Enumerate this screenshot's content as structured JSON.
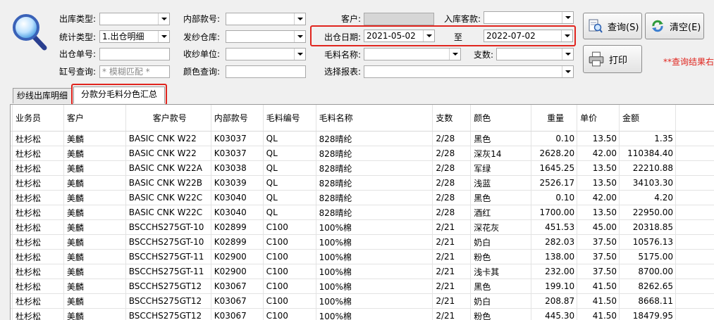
{
  "form": {
    "out_type_label": "出库类型:",
    "out_type_value": "",
    "stat_type_label": "统计类型:",
    "stat_type_value": "1.出仓明细",
    "out_no_label": "出仓单号:",
    "out_no_value": "",
    "vat_query_label": "缸号查询:",
    "vat_query_placeholder": "* 模糊匹配 *",
    "inner_style_label": "内部款号:",
    "inner_style_value": "",
    "warehouse_label": "发纱仓库:",
    "warehouse_value": "",
    "receiver_label": "收纱单位:",
    "receiver_value": "",
    "color_query_label": "颜色查询:",
    "color_query_value": "",
    "customer_label": "客户:",
    "customer_value": "",
    "in_customer_label": "入库客款:",
    "in_customer_value": "",
    "date_label": "出仓日期:",
    "date_from": "2021-05-02",
    "date_to_label": "至",
    "date_to": "2022-07-02",
    "material_label": "毛料名称:",
    "material_value": "",
    "count_label": "支数:",
    "count_value": "",
    "report_label": "选择报表:",
    "report_value": ""
  },
  "buttons": {
    "query": "查询(S)",
    "clear": "清空(E)",
    "print": "打印"
  },
  "hint": "**查询结果右",
  "tabs": [
    {
      "label": "纱线出库明细"
    },
    {
      "label": "分款分毛料分色汇总"
    }
  ],
  "table": {
    "headers": [
      "业务员",
      "客户",
      "客户款号",
      "内部款号",
      "毛料编号",
      "毛料名称",
      "支数",
      "颜色",
      "重量",
      "单价",
      "金额"
    ],
    "rows": [
      [
        "杜杉松",
        "美麟",
        "BASIC CNK W22",
        "K03037",
        "QL",
        "828晴纶",
        "2/28",
        "黑色",
        "0.10",
        "13.50",
        "1.35"
      ],
      [
        "杜杉松",
        "美麟",
        "BASIC CNK W22",
        "K03037",
        "QL",
        "828晴纶",
        "2/28",
        "深灰14",
        "2628.20",
        "42.00",
        "110384.40"
      ],
      [
        "杜杉松",
        "美麟",
        "BASIC CNK W22A",
        "K03038",
        "QL",
        "828晴纶",
        "2/28",
        "军绿",
        "1645.25",
        "13.50",
        "22210.88"
      ],
      [
        "杜杉松",
        "美麟",
        "BASIC CNK W22B",
        "K03039",
        "QL",
        "828晴纶",
        "2/28",
        "浅蓝",
        "2526.17",
        "13.50",
        "34103.30"
      ],
      [
        "杜杉松",
        "美麟",
        "BASIC CNK W22C",
        "K03040",
        "QL",
        "828晴纶",
        "2/28",
        "黑色",
        "0.10",
        "42.00",
        "4.20"
      ],
      [
        "杜杉松",
        "美麟",
        "BASIC CNK W22C",
        "K03040",
        "QL",
        "828晴纶",
        "2/28",
        "酒红",
        "1700.00",
        "13.50",
        "22950.00"
      ],
      [
        "杜杉松",
        "美麟",
        "BSCCHS275GT-10",
        "K02899",
        "C100",
        "100%棉",
        "2/21",
        "深花灰",
        "451.53",
        "45.00",
        "20318.85"
      ],
      [
        "杜杉松",
        "美麟",
        "BSCCHS275GT-10",
        "K02899",
        "C100",
        "100%棉",
        "2/21",
        "奶白",
        "282.03",
        "37.50",
        "10576.13"
      ],
      [
        "杜杉松",
        "美麟",
        "BSCCHS275GT-11",
        "K02900",
        "C100",
        "100%棉",
        "2/21",
        "粉色",
        "138.00",
        "37.50",
        "5175.00"
      ],
      [
        "杜杉松",
        "美麟",
        "BSCCHS275GT-11",
        "K02900",
        "C100",
        "100%棉",
        "2/21",
        "浅卡其",
        "232.00",
        "37.50",
        "8700.00"
      ],
      [
        "杜杉松",
        "美麟",
        "BSCCHS275GT12",
        "K03067",
        "C100",
        "100%棉",
        "2/21",
        "黑色",
        "199.10",
        "41.50",
        "8262.65"
      ],
      [
        "杜杉松",
        "美麟",
        "BSCCHS275GT12",
        "K03067",
        "C100",
        "100%棉",
        "2/21",
        "奶白",
        "208.87",
        "41.50",
        "8668.11"
      ],
      [
        "杜杉松",
        "美麟",
        "BSCCHS275GT12",
        "K03067",
        "C100",
        "100%棉",
        "2/21",
        "粉色",
        "445.30",
        "41.50",
        "18479.95"
      ]
    ]
  }
}
